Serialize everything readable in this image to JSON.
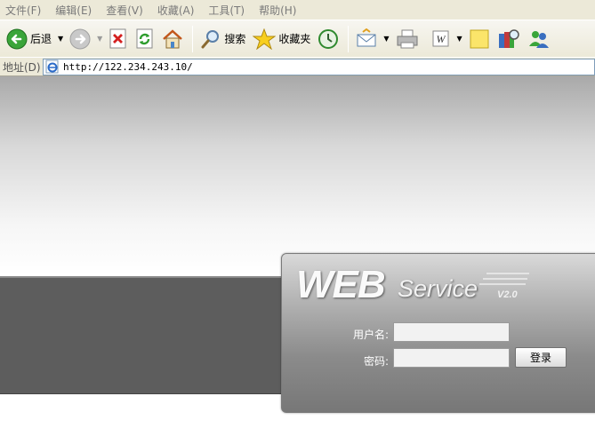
{
  "menu": [
    "文件(F)",
    "编辑(E)",
    "查看(V)",
    "收藏(A)",
    "工具(T)",
    "帮助(H)"
  ],
  "toolbar": {
    "back_label": "后退",
    "search_label": "搜索",
    "favorites_label": "收藏夹"
  },
  "address": {
    "label": "地址(D)",
    "url": "http://122.234.243.10/"
  },
  "login": {
    "logo_web": "WEB",
    "logo_service": "Service",
    "logo_version": "V2.0",
    "username_label": "用户名:",
    "password_label": "密码:",
    "username_value": "",
    "password_value": "",
    "submit_label": "登录"
  },
  "colors": {
    "chrome": "#ece9d8",
    "dark_band": "#5d5d5d",
    "panel": "#999999"
  }
}
